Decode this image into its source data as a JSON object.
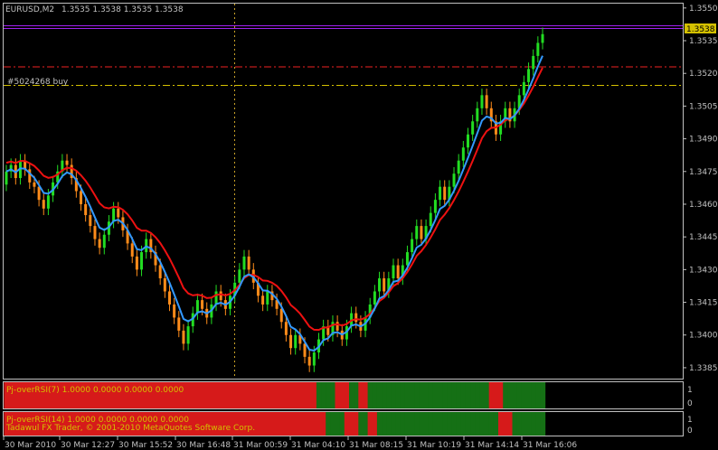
{
  "header": {
    "symbol": "EURUSD,M2",
    "ohlc": "1.3535 1.3538 1.3535 1.3538"
  },
  "price_axis": {
    "labels": [
      "1.3550",
      "1.3535",
      "1.3520",
      "1.3505",
      "1.3490",
      "1.3475",
      "1.3460",
      "1.3445",
      "1.3430",
      "1.3415",
      "1.3400",
      "1.3385"
    ],
    "current_price": "1.3538"
  },
  "order_line": {
    "label": "#5024268 buy"
  },
  "time_axis": {
    "labels": [
      "30 Mar 2010",
      "30 Mar 12:27",
      "30 Mar 15:52",
      "30 Mar 16:48",
      "31 Mar 00:59",
      "31 Mar 04:10",
      "31 Mar 08:15",
      "31 Mar 10:19",
      "31 Mar 14:14",
      "31 Mar 16:06"
    ]
  },
  "indicators": [
    {
      "label": "Pj-overRSI(7) 1.0000 0.0000 0.0000 0.0000",
      "scale_top": "1",
      "scale_bottom": "0"
    },
    {
      "label": "Pj-overRSI(14) 1.0000 0.0000 0.0000 0.0000",
      "scale_top": "1",
      "scale_bottom": "0"
    }
  ],
  "copyright": "Tadawul FX Trader, © 2001-2010 MetaQuotes Software Corp.",
  "colors": {
    "up": "#22dd22",
    "down": "#ff8c1a",
    "ma_fast": "#3399ff",
    "ma_slow": "#ee1111",
    "ind_red": "#d61a1a",
    "ind_green": "#157015"
  },
  "chart_data": {
    "type": "renko",
    "ylim": [
      1.338,
      1.3552
    ],
    "current_price": 1.3538,
    "order_price": 1.35145,
    "stop_price": 1.3523,
    "close": [
      1.3475,
      1.3478,
      1.3472,
      1.348,
      1.3476,
      1.347,
      1.3468,
      1.3462,
      1.3458,
      1.3464,
      1.347,
      1.3475,
      1.348,
      1.3478,
      1.3472,
      1.3466,
      1.346,
      1.3455,
      1.345,
      1.3444,
      1.344,
      1.3446,
      1.3452,
      1.3458,
      1.3454,
      1.3448,
      1.3442,
      1.3436,
      1.343,
      1.3438,
      1.3444,
      1.3438,
      1.3432,
      1.3426,
      1.342,
      1.3414,
      1.3408,
      1.3402,
      1.3396,
      1.3404,
      1.341,
      1.3416,
      1.3412,
      1.3408,
      1.3414,
      1.342,
      1.3416,
      1.3412,
      1.3418,
      1.3424,
      1.343,
      1.3436,
      1.343,
      1.3424,
      1.3418,
      1.3414,
      1.342,
      1.3416,
      1.3412,
      1.3406,
      1.34,
      1.3394,
      1.34,
      1.3396,
      1.339,
      1.3386,
      1.3392,
      1.3398,
      1.3404,
      1.34,
      1.3406,
      1.3402,
      1.3398,
      1.3404,
      1.341,
      1.3406,
      1.3402,
      1.3408,
      1.3414,
      1.342,
      1.3426,
      1.342,
      1.3426,
      1.3432,
      1.3426,
      1.3432,
      1.3438,
      1.3444,
      1.345,
      1.3444,
      1.345,
      1.3456,
      1.3462,
      1.3468,
      1.3462,
      1.3468,
      1.3474,
      1.348,
      1.3486,
      1.3492,
      1.3498,
      1.3504,
      1.351,
      1.3504,
      1.3498,
      1.3492,
      1.3498,
      1.3504,
      1.3498,
      1.3504,
      1.351,
      1.3516,
      1.3522,
      1.3528,
      1.3534,
      1.3538
    ]
  }
}
